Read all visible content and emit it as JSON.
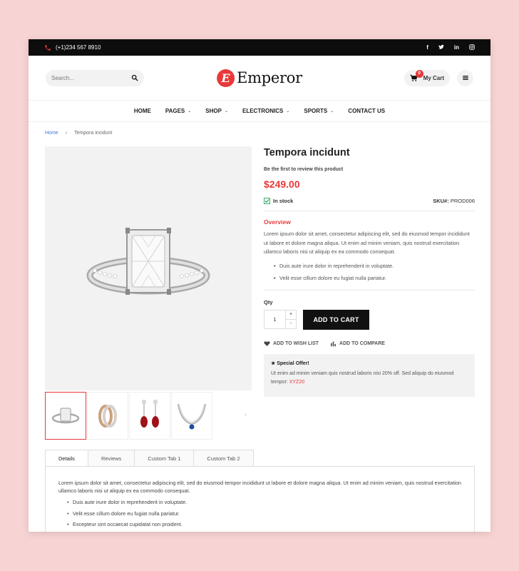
{
  "topbar": {
    "phone": "(+1)234 567 8910",
    "social": [
      "f",
      "t",
      "in",
      "ig"
    ]
  },
  "header": {
    "search_placeholder": "Search...",
    "logo_letter": "E",
    "logo_text": "Emperor",
    "cart_count": "0",
    "cart_label": "My Cart"
  },
  "nav": {
    "items": [
      {
        "label": "HOME",
        "has_dropdown": false
      },
      {
        "label": "PAGES",
        "has_dropdown": true
      },
      {
        "label": "SHOP",
        "has_dropdown": true
      },
      {
        "label": "ELECTRONICS",
        "has_dropdown": true
      },
      {
        "label": "SPORTS",
        "has_dropdown": true
      },
      {
        "label": "CONTACT US",
        "has_dropdown": false
      }
    ]
  },
  "breadcrumb": {
    "home": "Home",
    "current": "Tempora incidunt"
  },
  "product": {
    "title": "Tempora incidunt",
    "review_text": "Be the first to review this product",
    "price": "$249.00",
    "stock": "In stock",
    "sku_label": "SKU#:",
    "sku_value": "PROD006",
    "overview_title": "Overview",
    "overview_text": "Lorem ipsum dolor sit amet, consectetur adipiscing elit, sed do eiusmod tempor incididunt ut labore et dolore magna aliqua. Ut enim ad minim veniam, quis nostrud exercitation ullamco laboris nisi ut aliquip ex ea commodo consequat.",
    "bullets": [
      "Duis aute irure dolor in reprehenderit in voluptate.",
      "Velit esse cillum dolore eu fugiat nulla pariatur."
    ],
    "qty_label": "Qty",
    "qty_value": "1",
    "add_to_cart": "ADD TO CART",
    "wishlist": "ADD TO WISH LIST",
    "compare": "ADD TO COMPARE",
    "offer_title": "Special Offer!",
    "offer_text": "Ut enim ad minim veniam quis nostrud laboris nisi 20% off. Sed aliquip do eiusmod tempor:",
    "offer_code": "XYZ20"
  },
  "tabs": {
    "items": [
      "Details",
      "Reviews",
      "Custom Tab 1",
      "Custom Tab 2"
    ],
    "details_text": "Lorem ipsum dolor sit amet, consectetur adipiscing elit, sed do eiusmod tempor incididunt ut labore et dolore magna aliqua. Ut enim ad minim veniam, quis nostrud exercitation ullamco laboris nisi ut aliquip ex ea commodo consequat.",
    "details_bullets": [
      "Duis aute irure dolor in reprehenderit in voluptate.",
      "Velit esse cillum dolore eu fugiat nulla pariatur.",
      "Excepteur sint occaecat cupidatat non proident."
    ]
  },
  "colors": {
    "accent": "#e8393a",
    "topbar": "#0d0d0d",
    "page_bg": "#f7d3d3"
  }
}
